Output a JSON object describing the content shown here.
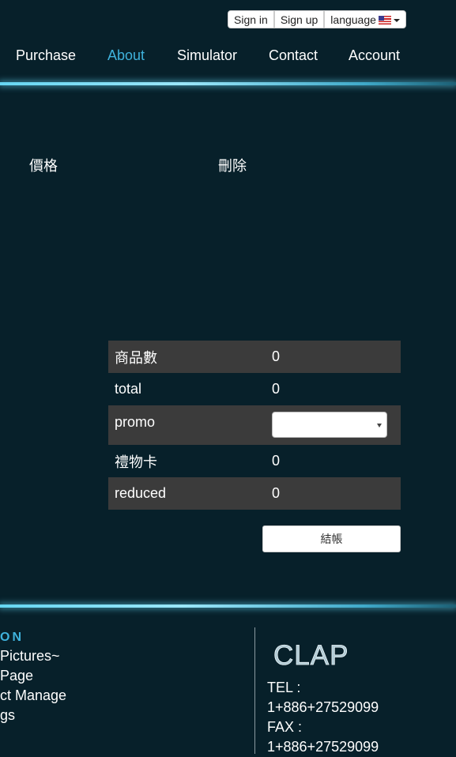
{
  "topbar": {
    "sign_in": "Sign in",
    "sign_up": "Sign up",
    "language": "language"
  },
  "nav": {
    "purchase": "Purchase",
    "about": "About",
    "simulator": "Simulator",
    "contact": "Contact",
    "account": "Account"
  },
  "cart": {
    "col_price": "價格",
    "col_delete": "刪除"
  },
  "summary": {
    "items_label": "商品數",
    "items_value": "0",
    "total_label": "total",
    "total_value": "0",
    "promo_label": "promo",
    "giftcard_label": "禮物卡",
    "giftcard_value": "0",
    "reduced_label": "reduced",
    "reduced_value": "0"
  },
  "checkout_label": "結帳",
  "footer": {
    "heading": "ON",
    "links": [
      "Pictures~",
      " Page",
      "ct Manage",
      "gs"
    ],
    "logo": "CLAP",
    "tel_label": "TEL :",
    "tel_value": "1+886+27529099",
    "fax_label": "FAX :",
    "fax_value": "1+886+27529099"
  },
  "colors": {
    "background": "#07202a",
    "accent": "#3fb2dc",
    "row_dark": "#3b3b3b"
  }
}
